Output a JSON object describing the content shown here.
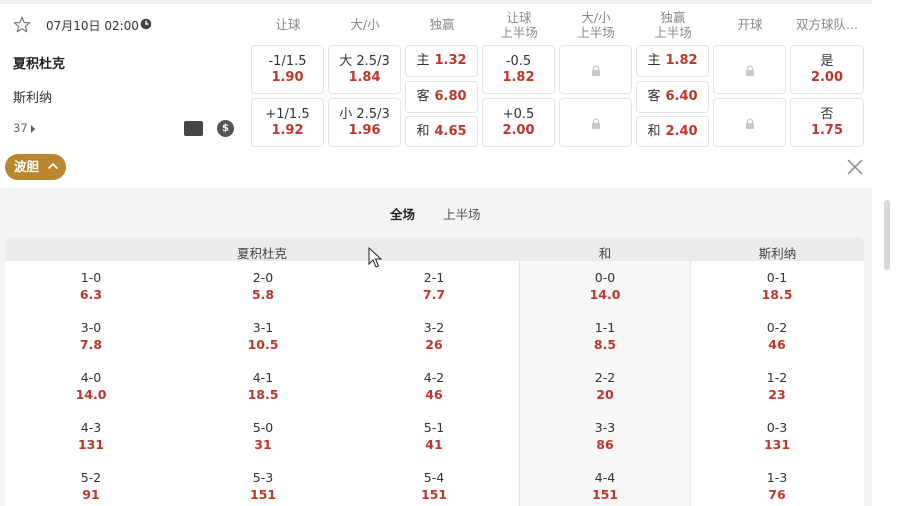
{
  "match": {
    "datetime": "07月10日 02:00",
    "home_team": "夏积杜克",
    "away_team": "斯利纳",
    "more_markets": "37"
  },
  "columns": [
    "让球",
    "大/小",
    "独赢",
    "让球\n上半场",
    "大/小\n上半场",
    "独赢\n上半场",
    "开球",
    "双方球队..."
  ],
  "odds": {
    "handicap": [
      {
        "line": "-1/1.5",
        "price": "1.90"
      },
      {
        "line": "+1/1.5",
        "price": "1.92"
      }
    ],
    "over_under": [
      {
        "line": "大 2.5/3",
        "price": "1.84"
      },
      {
        "line": "小 2.5/3",
        "price": "1.96"
      }
    ],
    "moneyline": [
      {
        "label": "主",
        "price": "1.32"
      },
      {
        "label": "客",
        "price": "6.80"
      },
      {
        "label": "和",
        "price": "4.65"
      }
    ],
    "handicap_half": [
      {
        "line": "-0.5",
        "price": "1.82"
      },
      {
        "line": "+0.5",
        "price": "2.00"
      }
    ],
    "moneyline_half": [
      {
        "label": "主",
        "price": "1.82"
      },
      {
        "label": "客",
        "price": "6.40"
      },
      {
        "label": "和",
        "price": "2.40"
      }
    ],
    "both_teams": [
      {
        "label": "是",
        "price": "2.00"
      },
      {
        "label": "否",
        "price": "1.75"
      }
    ]
  },
  "correct_score": {
    "toggle_label": "波胆",
    "tabs": [
      "全场",
      "上半场"
    ],
    "headers": {
      "home": "夏积杜克",
      "draw": "和",
      "away": "斯利纳"
    },
    "home_cells": [
      [
        {
          "score": "1-0",
          "price": "6.3"
        },
        {
          "score": "2-0",
          "price": "5.8"
        },
        {
          "score": "2-1",
          "price": "7.7"
        }
      ],
      [
        {
          "score": "3-0",
          "price": "7.8"
        },
        {
          "score": "3-1",
          "price": "10.5"
        },
        {
          "score": "3-2",
          "price": "26"
        }
      ],
      [
        {
          "score": "4-0",
          "price": "14.0"
        },
        {
          "score": "4-1",
          "price": "18.5"
        },
        {
          "score": "4-2",
          "price": "46"
        }
      ],
      [
        {
          "score": "4-3",
          "price": "131"
        },
        {
          "score": "5-0",
          "price": "31"
        },
        {
          "score": "5-1",
          "price": "41"
        }
      ],
      [
        {
          "score": "5-2",
          "price": "91"
        },
        {
          "score": "5-3",
          "price": "151"
        },
        {
          "score": "5-4",
          "price": "151"
        }
      ]
    ],
    "draw_cells": [
      {
        "score": "0-0",
        "price": "14.0"
      },
      {
        "score": "1-1",
        "price": "8.5"
      },
      {
        "score": "2-2",
        "price": "20"
      },
      {
        "score": "3-3",
        "price": "86"
      },
      {
        "score": "4-4",
        "price": "151"
      }
    ],
    "away_cells": [
      {
        "score": "0-1",
        "price": "18.5"
      },
      {
        "score": "0-2",
        "price": "46"
      },
      {
        "score": "1-2",
        "price": "23"
      },
      {
        "score": "0-3",
        "price": "131"
      },
      {
        "score": "1-3",
        "price": "76"
      }
    ]
  },
  "colors": {
    "price": "#c0352b",
    "accent": "#b8862d"
  }
}
